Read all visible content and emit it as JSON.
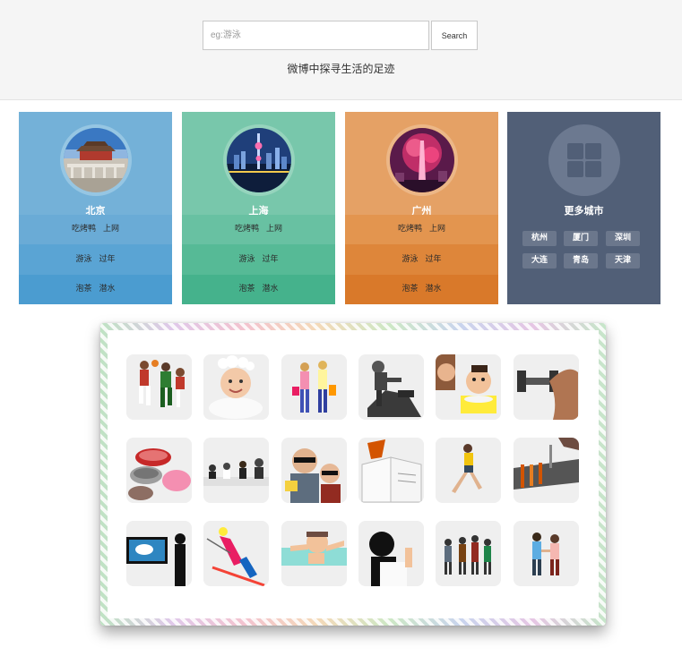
{
  "search": {
    "placeholder": "eg:游泳",
    "button_label": "Search"
  },
  "tagline": "微博中探寻生活的足迹",
  "cities": [
    {
      "name": "北京",
      "rows": [
        [
          "吃烤鸭",
          "上网"
        ],
        [
          "游泳",
          "过年"
        ],
        [
          "泡茶",
          "潜水"
        ]
      ]
    },
    {
      "name": "上海",
      "rows": [
        [
          "吃烤鸭",
          "上网"
        ],
        [
          "游泳",
          "过年"
        ],
        [
          "泡茶",
          "潜水"
        ]
      ]
    },
    {
      "name": "广州",
      "rows": [
        [
          "吃烤鸭",
          "上网"
        ],
        [
          "游泳",
          "过年"
        ],
        [
          "泡茶",
          "潜水"
        ]
      ]
    }
  ],
  "more_cities": {
    "title": "更多城市",
    "tags": [
      "杭州",
      "厦门",
      "深圳",
      "大连",
      "青岛",
      "天津"
    ]
  },
  "activities": [
    "basketball-players",
    "baby-bath",
    "shopping-women",
    "climber",
    "child-eating",
    "dumbbell-arm",
    "hot-pot-food",
    "meeting",
    "couple-3d-movie",
    "book-leaf",
    "runner",
    "barbecue-grill",
    "presentation-screen",
    "skier",
    "swimming-child",
    "woman-writing",
    "hikers",
    "couple-walking"
  ],
  "colors": {
    "beijing": "#74b1d8",
    "shanghai": "#78c7ab",
    "guangzhou": "#e5a165",
    "more": "#515f77"
  }
}
